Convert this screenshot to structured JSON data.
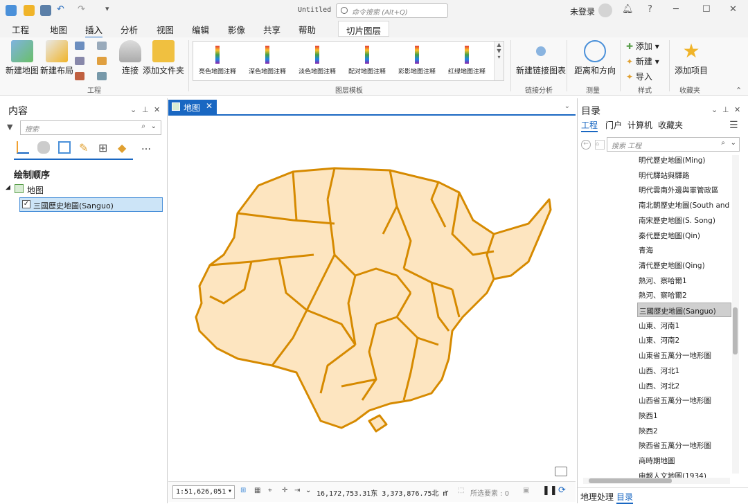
{
  "titlebar": {
    "title": "Untitled",
    "command_search_placeholder": "命令搜索 (Alt+Q)",
    "user": "未登录",
    "help": "?"
  },
  "tabs": [
    "工程",
    "地图",
    "插入",
    "分析",
    "视图",
    "编辑",
    "影像",
    "共享",
    "帮助",
    "切片图层"
  ],
  "ribbon": {
    "project_group": {
      "new_map": "新建地图",
      "new_layout": "新建布局",
      "connect": "连接",
      "add_folder": "添加文件夹",
      "group_label": "工程"
    },
    "layer_templates": {
      "items": [
        "亮色地图注释",
        "深色地图注释",
        "淡色地图注释",
        "配对地图注释",
        "彩影地图注释",
        "红绿地图注释"
      ],
      "group_label": "图层模板"
    },
    "link_analysis": {
      "new_link_chart": "新建链接图表",
      "group_label": "链接分析"
    },
    "measure": {
      "distance_direction": "距离和方向",
      "group_label": "测量"
    },
    "styles": {
      "add": "添加",
      "new": "新建",
      "import": "导入",
      "group_label": "样式"
    },
    "favorites": {
      "add_item": "添加项目",
      "group_label": "收藏夹"
    }
  },
  "contents": {
    "title": "内容",
    "search_placeholder": "搜索",
    "drawing_order": "绘制顺序",
    "map_name": "地图",
    "layer_name": "三國歷史地圖(Sanguo)"
  },
  "map": {
    "tab_label": "地图",
    "scale": "1:51,626,051",
    "coordinates": "16,172,753.31东 3,373,876.75北 m",
    "selected_features": "所选要素 : 0"
  },
  "catalog": {
    "title": "目录",
    "subtabs": [
      "工程",
      "门户",
      "计算机",
      "收藏夹"
    ],
    "search_placeholder": "搜索 工程",
    "items": [
      "明代歷史地圖(Ming)",
      "明代驛站與驛路",
      "明代雲南外邊與軍管政區",
      "南北朝歷史地圖(South and",
      "南宋歷史地圖(S. Song)",
      "秦代歷史地圖(Qin)",
      "青海",
      "清代歷史地圖(Qing)",
      "熱河、察哈爾1",
      "熱河、察哈爾2",
      "三國歷史地圖(Sanguo)",
      "山東、河南1",
      "山東、河南2",
      "山東省五萬分一地形圖",
      "山西、河北1",
      "山西、河北2",
      "山西省五萬分一地形圖",
      "陝西1",
      "陝西2",
      "陝西省五萬分一地形圖",
      "商時期地圖",
      "申報人文地圖(1934)"
    ],
    "selected_index": 10,
    "bottom_tabs": [
      "地理处理",
      "目录"
    ]
  },
  "colors": {
    "accent": "#1967c2",
    "map_fill": "#fde5c0",
    "map_stroke": "#d68a00"
  }
}
